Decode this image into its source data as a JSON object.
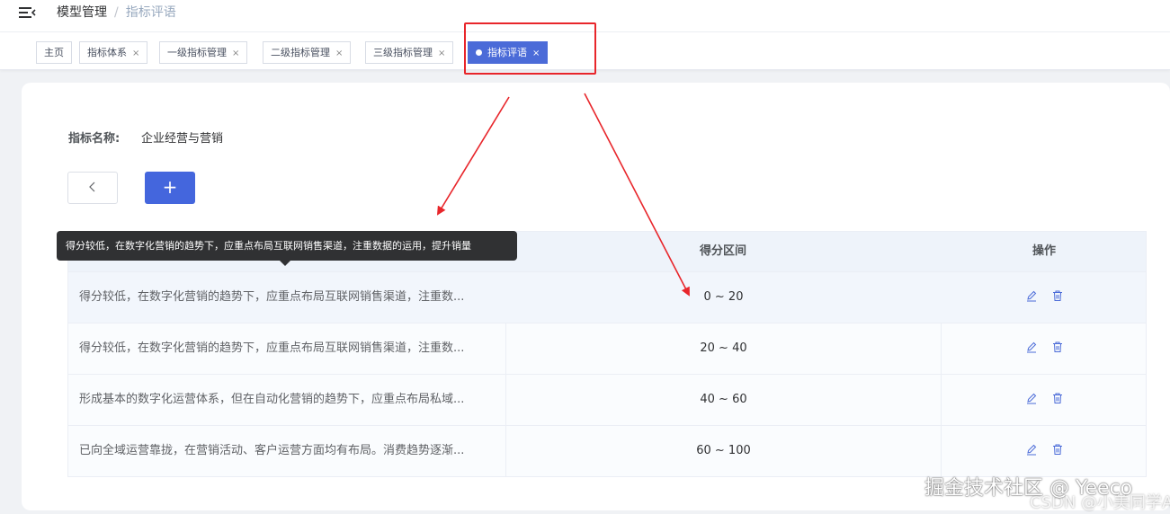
{
  "header": {
    "breadcrumb": [
      "模型管理",
      "指标评语"
    ],
    "separator": "/"
  },
  "tags": [
    {
      "label": "主页",
      "closable": false
    },
    {
      "label": "指标体系",
      "closable": true
    },
    {
      "label": "一级指标管理",
      "closable": true
    },
    {
      "label": "二级指标管理",
      "closable": true
    },
    {
      "label": "三级指标管理",
      "closable": true
    },
    {
      "label": "指标评语",
      "closable": true,
      "active": true
    }
  ],
  "close_glyph": "×",
  "form": {
    "label": "指标名称:",
    "value": "企业经营与营销"
  },
  "buttons": {
    "back_icon": "chevron-left-icon",
    "add_label": "+"
  },
  "table": {
    "columns": [
      "",
      "得分区间",
      "操作"
    ],
    "rows": [
      {
        "text": "得分较低，在数字化营销的趋势下，应重点布局互联网销售渠道，注重数...",
        "range": "0 ~ 20"
      },
      {
        "text": "得分较低，在数字化营销的趋势下，应重点布局互联网销售渠道，注重数...",
        "range": "20 ~ 40"
      },
      {
        "text": "形成基本的数字化运营体系，但在自动化营销的趋势下，应重点布局私域...",
        "range": "40 ~ 60"
      },
      {
        "text": "已向全域运营靠拢，在营销活动、客户运营方面均有布局。消费趋势逐渐...",
        "range": "60 ~ 100"
      }
    ]
  },
  "tooltip": {
    "text": "得分较低，在数字化营销的趋势下，应重点布局互联网销售渠道，注重数据的运用，提升销量"
  },
  "watermark": {
    "line1": "掘金技术社区 @ Yeeco",
    "line2": "CSDN @小美同学A"
  },
  "colors": {
    "primary": "#4466dd",
    "annotation_red": "#e8262b"
  }
}
